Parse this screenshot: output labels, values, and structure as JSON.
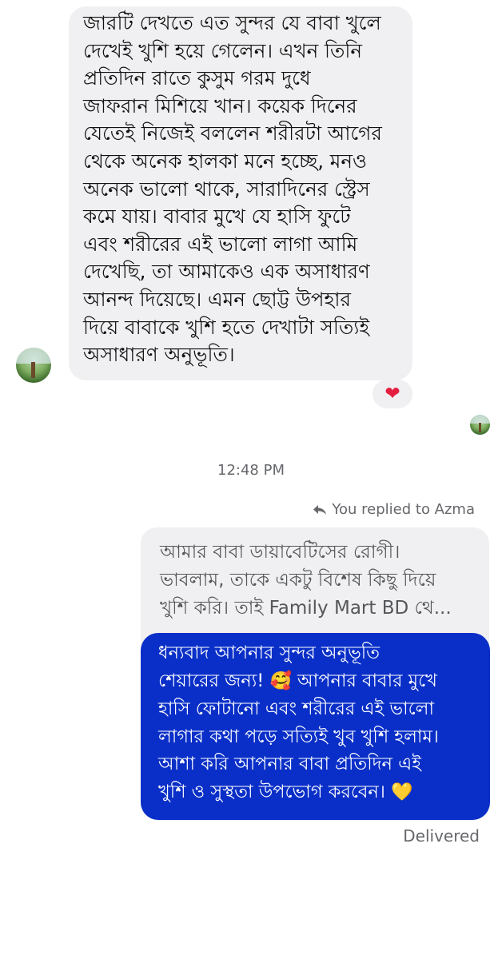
{
  "incoming_message": {
    "text": "জারটি দেখতে এত সুন্দর যে বাবা খুলে\nদেখেই খুশি হয়ে গেলেন। এখন তিনি\nপ্রতিদিন রাতে কুসুম গরম দুধে\nজাফরান মিশিয়ে খান। কয়েক দিনের\nযেতেই নিজেই বললেন শরীরটা আগের\nথেকে অনেক হালকা মনে হচ্ছে, মনও\nঅনেক ভালো থাকে, সারাদিনের স্ট্রেস\nকমে যায়। বাবার মুখে যে হাসি ফুটে\nএবং শরীরের এই ভালো লাগা আমি\nদেখেছি, তা আমাকেও এক অসাধারণ\nআনন্দ দিয়েছে। এমন ছোট্ট উপহার\nদিয়ে বাবাকে খুশি হতে দেখাটা সত্যিই\nঅসাধারণ অনুভূতি।",
    "reaction": "❤"
  },
  "timestamp": "12:48 PM",
  "reply_context": {
    "label": "You replied to Azma",
    "quoted_text": "আমার বাবা ডায়াবেটিসের রোগী।\nভাবলাম, তাকে একটু বিশেষ কিছু দিয়ে\nখুশি করি। তাই Family Mart BD থে..."
  },
  "outgoing_message": {
    "line1": "ধন্যবাদ আপনার সুন্দর অনুভূতি",
    "line2a": "শেয়ারের জন্য! ",
    "emoji1": "🥰",
    "line2b": " আপনার বাবার মুখে",
    "rest": "হাসি ফোটানো এবং শরীরের এই ভালো\nলাগার কথা পড়ে সত্যিই খুব খুশি হলাম।\nআশা করি আপনার বাবা প্রতিদিন এই",
    "last_line": "খুশি ও সুস্থতা উপভোগ করবেন। ",
    "emoji2": "💛"
  },
  "status": "Delivered",
  "colors": {
    "outgoing_bubble": "#0a2fc8",
    "incoming_bubble": "#f0f0f2",
    "reaction_heart": "#e41e3f"
  }
}
